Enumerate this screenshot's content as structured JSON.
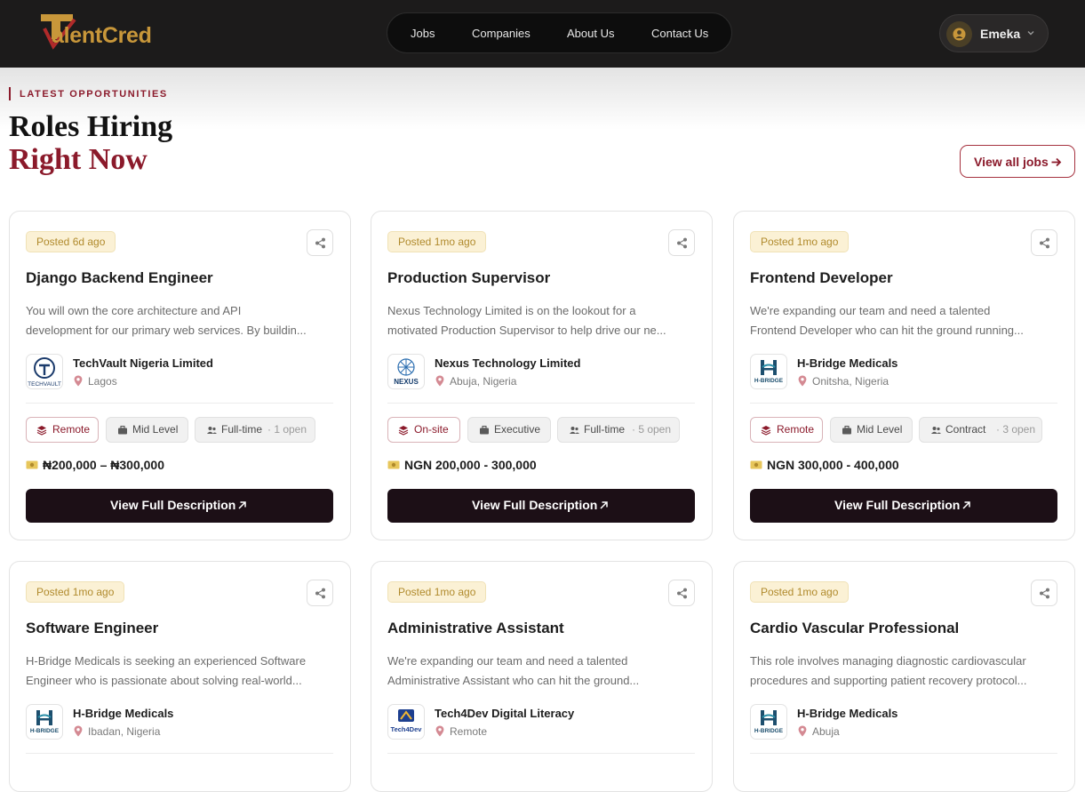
{
  "brand": {
    "logo_text": "alentCred",
    "logo_mark": "T",
    "logo_color": "#c8973a"
  },
  "nav": {
    "items": [
      "Jobs",
      "Companies",
      "About Us",
      "Contact Us"
    ]
  },
  "user": {
    "name": "Emeka"
  },
  "section": {
    "eyebrow": "LATEST OPPORTUNITIES",
    "title_line1": "Roles Hiring",
    "title_line2": "Right Now",
    "view_all_label": "View all jobs"
  },
  "colors": {
    "accent": "#8b1a2b",
    "dark": "#1c0f16",
    "badge_bg": "#fbf1d5",
    "badge_text": "#b08a2c"
  },
  "jobs": [
    {
      "posted": "Posted 6d ago",
      "title": "Django Backend Engineer",
      "desc_line1": "You will own the core architecture and API",
      "desc_line2": "development for our primary web services. By buildin...",
      "company": "TechVault Nigeria Limited",
      "location": "Lagos",
      "work_mode": "Remote",
      "level": "Mid Level",
      "type": "Full-time",
      "openings": "· 1 open",
      "salary": "₦200,000 – ₦300,000",
      "cta": "View Full Description",
      "logo_icon": "techvault-logo",
      "logo_caption": "TECHVAULT"
    },
    {
      "posted": "Posted 1mo ago",
      "title": "Production Supervisor",
      "desc_line1": "Nexus Technology Limited is on the lookout for a",
      "desc_line2": "motivated Production Supervisor to help drive our ne...",
      "company": "Nexus Technology Limited",
      "location": "Abuja, Nigeria",
      "work_mode": "On-site",
      "level": "Executive",
      "type": "Full-time",
      "openings": "· 5 open",
      "salary": "NGN 200,000 - 300,000",
      "cta": "View Full Description",
      "logo_icon": "nexus-logo",
      "logo_caption": "NEXUS"
    },
    {
      "posted": "Posted 1mo ago",
      "title": "Frontend Developer",
      "desc_line1": "We're expanding our team and need a talented",
      "desc_line2": "Frontend Developer who can hit the ground running...",
      "company": "H-Bridge Medicals",
      "location": "Onitsha, Nigeria",
      "work_mode": "Remote",
      "level": "Mid Level",
      "type": "Contract",
      "openings": "· 3 open",
      "salary": "NGN 300,000 - 400,000",
      "cta": "View Full Description",
      "logo_icon": "h-bridge-logo",
      "logo_caption": "H-BRIDGE"
    },
    {
      "posted": "Posted 1mo ago",
      "title": "Software Engineer",
      "desc_line1": "H-Bridge Medicals is seeking an experienced Software",
      "desc_line2": "Engineer who is passionate about solving real-world...",
      "company": "H-Bridge Medicals",
      "location": "Ibadan, Nigeria",
      "logo_icon": "h-bridge-logo",
      "logo_caption": "H-BRIDGE"
    },
    {
      "posted": "Posted 1mo ago",
      "title": "Administrative Assistant",
      "desc_line1": "We're expanding our team and need a talented",
      "desc_line2": "Administrative Assistant who can hit the ground...",
      "company": "Tech4Dev Digital Literacy",
      "location": "Remote",
      "logo_icon": "tech4dev-logo",
      "logo_caption": "Tech4Dev"
    },
    {
      "posted": "Posted 1mo ago",
      "title": "Cardio Vascular Professional",
      "desc_line1": "This role involves managing diagnostic cardiovascular",
      "desc_line2": "procedures and supporting patient recovery protocol...",
      "company": "H-Bridge Medicals",
      "location": "Abuja",
      "logo_icon": "h-bridge-logo",
      "logo_caption": "H-BRIDGE"
    }
  ]
}
